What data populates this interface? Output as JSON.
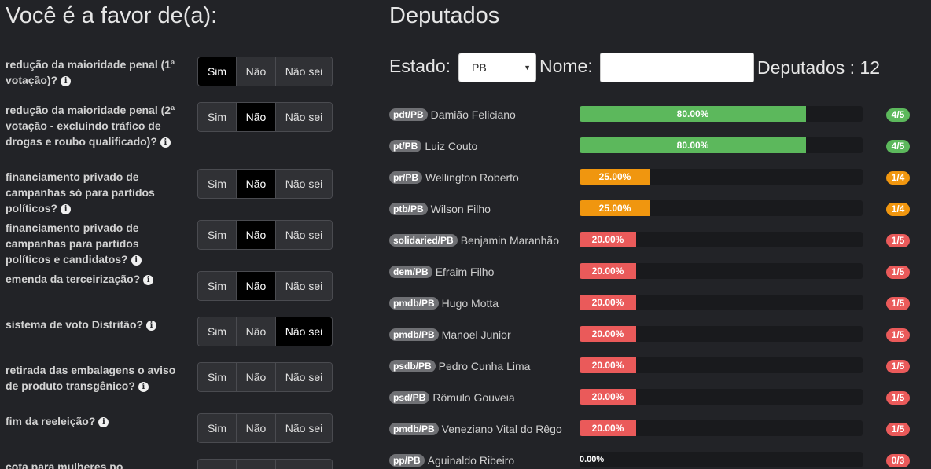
{
  "left": {
    "title": "Você é a favor de(a):",
    "options": {
      "sim": "Sim",
      "nao": "Não",
      "nao_sei": "Não sei"
    },
    "questions": [
      {
        "text": "redução da maioridade penal (1ª votação)?",
        "selected": "sim"
      },
      {
        "text": "redução da maioridade penal (2ª votação - excluindo tráfico de drogas e roubo qualificado)?",
        "selected": "nao"
      },
      {
        "text": "financiamento privado de campanhas só para partidos políticos?",
        "selected": "nao"
      },
      {
        "text": "financiamento privado de campanhas para partidos políticos e candidatos?",
        "selected": "nao"
      },
      {
        "text": "emenda da terceirização?",
        "selected": "nao"
      },
      {
        "text": "sistema de voto Distritão?",
        "selected": "nao_sei"
      },
      {
        "text": "retirada das embalagens o aviso de produto transgênico?",
        "selected": "none"
      },
      {
        "text": "fim da reeleição?",
        "selected": "none"
      },
      {
        "text": "cota para mulheres no",
        "selected": "none"
      }
    ]
  },
  "right": {
    "title": "Deputados",
    "filter": {
      "estado_label": "Estado:",
      "estado_value": "PB",
      "nome_label": "Nome:",
      "nome_value": "",
      "count_text": "Deputados : 12"
    },
    "colors": {
      "green": "#5cb85c",
      "orange": "#f0960f",
      "red": "#ea5a5a"
    },
    "deputies": [
      {
        "party": "pdt/PB",
        "name": "Damião Feliciano",
        "percent": 80,
        "percent_label": "80.00%",
        "score": "4/5",
        "color": "green"
      },
      {
        "party": "pt/PB",
        "name": "Luiz Couto",
        "percent": 80,
        "percent_label": "80.00%",
        "score": "4/5",
        "color": "green"
      },
      {
        "party": "pr/PB",
        "name": "Wellington Roberto",
        "percent": 25,
        "percent_label": "25.00%",
        "score": "1/4",
        "color": "orange"
      },
      {
        "party": "ptb/PB",
        "name": "Wilson Filho",
        "percent": 25,
        "percent_label": "25.00%",
        "score": "1/4",
        "color": "orange"
      },
      {
        "party": "solidaried/PB",
        "name": "Benjamin Maranhão",
        "percent": 20,
        "percent_label": "20.00%",
        "score": "1/5",
        "color": "red"
      },
      {
        "party": "dem/PB",
        "name": "Efraim Filho",
        "percent": 20,
        "percent_label": "20.00%",
        "score": "1/5",
        "color": "red"
      },
      {
        "party": "pmdb/PB",
        "name": "Hugo Motta",
        "percent": 20,
        "percent_label": "20.00%",
        "score": "1/5",
        "color": "red"
      },
      {
        "party": "pmdb/PB",
        "name": "Manoel Junior",
        "percent": 20,
        "percent_label": "20.00%",
        "score": "1/5",
        "color": "red"
      },
      {
        "party": "psdb/PB",
        "name": "Pedro Cunha Lima",
        "percent": 20,
        "percent_label": "20.00%",
        "score": "1/5",
        "color": "red"
      },
      {
        "party": "psd/PB",
        "name": "Rômulo Gouveia",
        "percent": 20,
        "percent_label": "20.00%",
        "score": "1/5",
        "color": "red"
      },
      {
        "party": "pmdb/PB",
        "name": "Veneziano Vital do Rêgo",
        "percent": 20,
        "percent_label": "20.00%",
        "score": "1/5",
        "color": "red"
      },
      {
        "party": "pp/PB",
        "name": "Aguinaldo Ribeiro",
        "percent": 0,
        "percent_label": "0.00%",
        "score": "0/3",
        "color": "red"
      }
    ]
  }
}
